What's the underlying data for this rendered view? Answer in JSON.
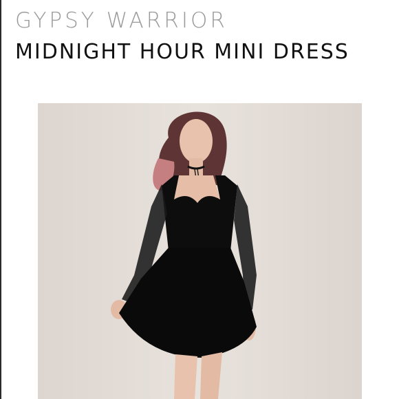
{
  "listing": {
    "brand": "GYPSY WARRIOR",
    "title": "MIDNIGHT HOUR MINI DRESS"
  },
  "photo": {
    "subject": "model-in-black-mini-dress",
    "colors": {
      "backdrop": "#e3dcd6",
      "dress": "#0d0d0d",
      "skin": "#e8c2ac",
      "hair": "#6a3a3a"
    }
  }
}
